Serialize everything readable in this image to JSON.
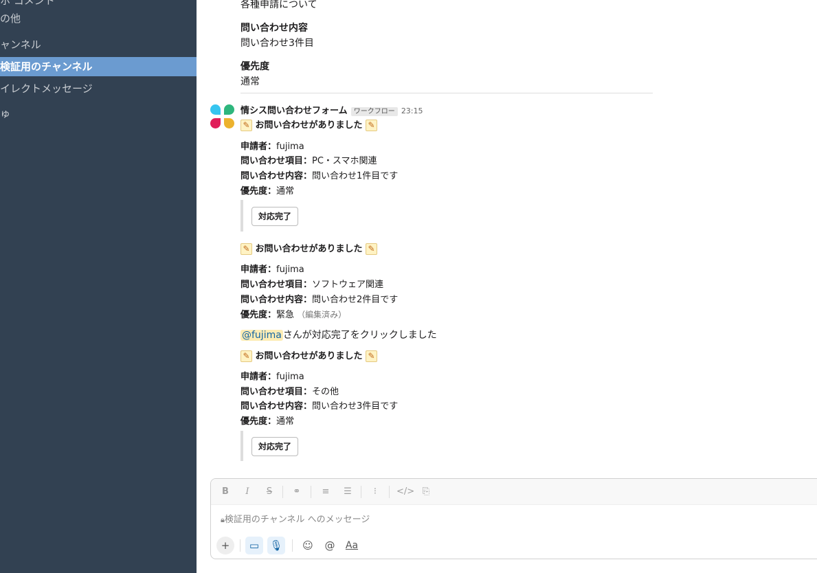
{
  "sidebar": {
    "items": [
      {
        "label": "ホ コメント",
        "active": false
      },
      {
        "label": "の他",
        "active": false
      },
      {
        "label": "ャンネル",
        "active": false
      },
      {
        "label": "検証用のチャンネル",
        "active": true
      },
      {
        "label": "イレクトメッセージ",
        "active": false
      },
      {
        "label": "ゅ",
        "active": false
      }
    ]
  },
  "prev_message": {
    "line1": "各種申請について",
    "content_label": "問い合わせ内容",
    "content_value": "問い合わせ3件目",
    "priority_label": "優先度",
    "priority_value": "通常"
  },
  "message": {
    "sender": "情シス問い合わせフォーム",
    "badge": "ワークフロー",
    "time": "23:15",
    "posts": [
      {
        "heading": "お問い合わせがありました",
        "applicant_label": "申請者：",
        "applicant": "fujima",
        "item_label": "問い合わせ項目：",
        "item": "PC・スマホ関連",
        "content_label": "問い合わせ内容：",
        "content": "問い合わせ1件目です",
        "priority_label": "優先度：",
        "priority": "通常",
        "button": "対応完了"
      },
      {
        "heading": "お問い合わせがありました",
        "applicant_label": "申請者：",
        "applicant": "fujima",
        "item_label": "問い合わせ項目：",
        "item": "ソフトウェア関連",
        "content_label": "問い合わせ内容：",
        "content": "問い合わせ2件目です",
        "priority_label": "優先度：",
        "priority": "緊急",
        "edited": "（編集済み）",
        "completed_mention": "@fujima",
        "completed_text": "さんが対応完了をクリックしました"
      },
      {
        "heading": "お問い合わせがありました",
        "applicant_label": "申請者：",
        "applicant": "fujima",
        "item_label": "問い合わせ項目：",
        "item": "その他",
        "content_label": "問い合わせ内容：",
        "content": "問い合わせ3件目です",
        "priority_label": "優先度：",
        "priority": "通常",
        "button": "対応完了"
      }
    ]
  },
  "composer": {
    "toolbar_icons": [
      "bold-icon",
      "italic-icon",
      "strikethrough-icon",
      "link-icon",
      "ordered-list-icon",
      "bullet-list-icon",
      "blockquote-icon",
      "code-icon",
      "code-block-icon"
    ],
    "placeholder": "検証用のチャンネル へのメッセージ",
    "controls": [
      "plus-shortcut-icon",
      "video-icon",
      "microphone-icon",
      "emoji-icon",
      "mention-icon",
      "format-icon"
    ]
  },
  "colors": {
    "sidebar_bg": "#324152",
    "sidebar_active": "#6b9bd0",
    "mention_bg": "#fdecb4",
    "link_blue": "#1264a3"
  }
}
